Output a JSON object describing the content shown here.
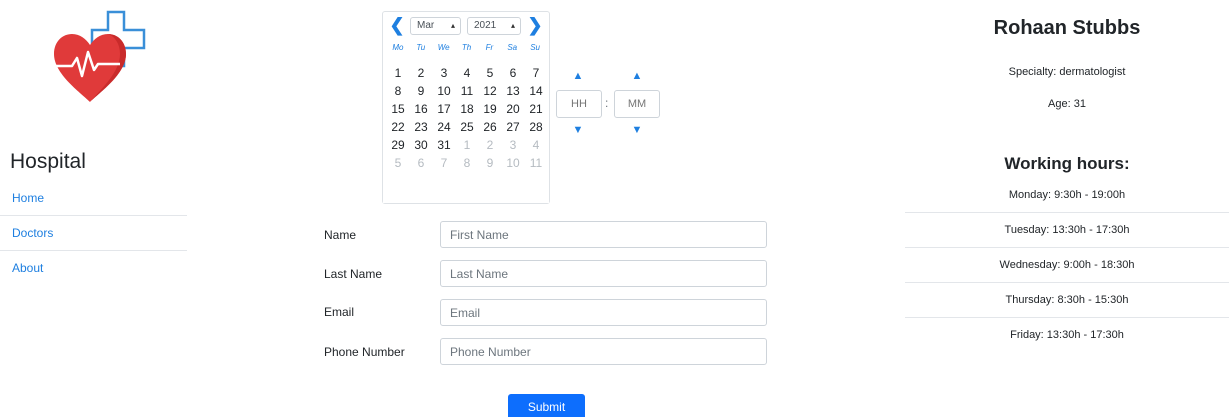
{
  "sidebar": {
    "brand": "Hospital",
    "nav": [
      {
        "label": "Home"
      },
      {
        "label": "Doctors"
      },
      {
        "label": "About"
      }
    ]
  },
  "calendar": {
    "month": "Mar",
    "year": "2021",
    "weekdays": [
      "Mo",
      "Tu",
      "We",
      "Th",
      "Fr",
      "Sa",
      "Su"
    ],
    "weeks": [
      [
        "1",
        "2",
        "3",
        "4",
        "5",
        "6",
        "7"
      ],
      [
        "8",
        "9",
        "10",
        "11",
        "12",
        "13",
        "14"
      ],
      [
        "15",
        "16",
        "17",
        "18",
        "19",
        "20",
        "21"
      ],
      [
        "22",
        "23",
        "24",
        "25",
        "26",
        "27",
        "28"
      ],
      [
        "29",
        "30",
        "31",
        "1",
        "2",
        "3",
        "4"
      ],
      [
        "5",
        "6",
        "7",
        "8",
        "9",
        "10",
        "11"
      ]
    ],
    "icons": {
      "prev": "chevron-left-icon",
      "next": "chevron-right-icon",
      "dropdown": "updown-icon"
    }
  },
  "timepicker": {
    "hours_placeholder": "HH",
    "minutes_placeholder": "MM",
    "separator": ":",
    "icons": {
      "up": "chevron-up-icon",
      "down": "chevron-down-icon"
    }
  },
  "form": {
    "fields": [
      {
        "label": "Name",
        "placeholder": "First Name",
        "value": ""
      },
      {
        "label": "Last Name",
        "placeholder": "Last Name",
        "value": ""
      },
      {
        "label": "Email",
        "placeholder": "Email",
        "value": ""
      },
      {
        "label": "Phone Number",
        "placeholder": "Phone Number",
        "value": ""
      }
    ],
    "submit_label": "Submit"
  },
  "doctor": {
    "name": "Rohaan Stubbs",
    "specialty": "Specialty: dermatologist",
    "age": "Age: 31",
    "working_hours_title": "Working hours:",
    "hours": [
      "Monday: 9:30h - 19:00h",
      "Tuesday: 13:30h - 17:30h",
      "Wednesday: 9:00h - 18:30h",
      "Thursday: 8:30h - 15:30h",
      "Friday: 13:30h - 17:30h"
    ]
  },
  "colors": {
    "accent": "#1e7fe0",
    "submit": "#0d6efd",
    "logo_heart": "#e03a3a",
    "logo_cross": "#3a8fd8"
  }
}
